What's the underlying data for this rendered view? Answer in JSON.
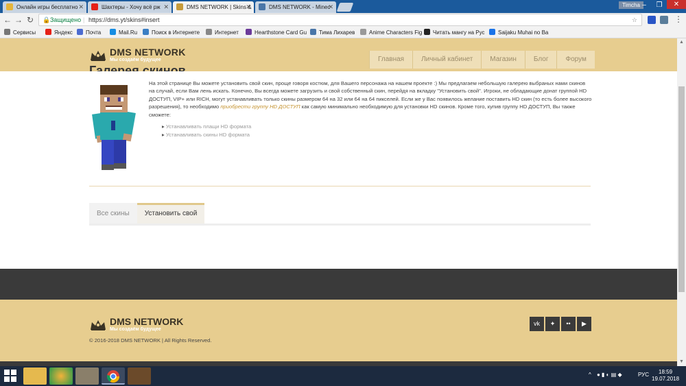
{
  "browser": {
    "tabs": [
      {
        "title": "Онлайн игры бесплатно",
        "favicon_color": "#e5b53c"
      },
      {
        "title": "Шахтеры - Хочу всё рж",
        "favicon_color": "#e62117"
      },
      {
        "title": "DMS NETWORK | Skins &",
        "favicon_color": "#c79b3a"
      },
      {
        "title": "DMS NETWORK - Minec",
        "favicon_color": "#4a76a8"
      }
    ],
    "window_user": "Timcha",
    "url_secure_label": "Защищено",
    "url": "https://dms.yt/skins#insert"
  },
  "bookmarks": [
    {
      "label": "Сервисы",
      "color": "#777"
    },
    {
      "label": "Яндекс",
      "color": "#e62117"
    },
    {
      "label": "Почта",
      "color": "#4b6bd1"
    },
    {
      "label": "Mail.Ru",
      "color": "#168de2"
    },
    {
      "label": "Поиск в Интернете",
      "color": "#3b7fc4"
    },
    {
      "label": "Интернет",
      "color": "#888"
    },
    {
      "label": "Hearthstone Card Gu",
      "color": "#6b3a9a"
    },
    {
      "label": "Тима Лихарев",
      "color": "#4a76a8"
    },
    {
      "label": "Anime Characters Fig",
      "color": "#999"
    },
    {
      "label": "Читать мангу на Рус",
      "color": "#222"
    },
    {
      "label": "Saijaku Muhai no Ba",
      "color": "#1a73e8"
    }
  ],
  "site": {
    "logo_name": "DMS NETWORK",
    "logo_slogan": "Мы создаём будущее",
    "nav": [
      "Главная",
      "Личный кабинет",
      "Магазин",
      "Блог",
      "Форум"
    ],
    "page_title": "Галерея скинов",
    "intro_1": "На этой странице Вы можете установить свой скин, проще говоря костюм, для Вашего персонажа на нашем проекте :) Мы предлагаем небольшую галерею выбраных нами скинов на случай, если Вам лень искать. Конечно, Вы всегда можете загрузить и свой собственный скин, перейдя на вкладку \"Установить свой\". Игроки, не обладающие донат группой HD ДОСТУП, VIP+ или RICH, могут устанавливать только скины размером 64 на 32 или 64 на 64 пикселей. Если же у Вас появилось желание поставить HD скин (то есть более высокого разрешения), то необходимо ",
    "intro_link": "приобрести группу HD ДОСТУП",
    "intro_2": " как самую минимально необходимую для установки HD скинов. Кроме того, купив группу HD ДОСТУП, Вы также сможете:",
    "features": [
      "Устанавливать плащи HD формата",
      "Устанавливать скины HD формата"
    ],
    "skin_tabs": [
      {
        "label": "Все скины",
        "active": false
      },
      {
        "label": "Установить свой",
        "active": true
      }
    ],
    "footer_logo_name": "DMS NETWORK",
    "footer_logo_slogan": "Мы создаём будущее",
    "copyright": "© 2016-2018 DMS NETWORK | All Rights Reserved.",
    "social_icons": [
      "vk-icon",
      "twitter-icon",
      "flickr-icon",
      "youtube-icon"
    ]
  },
  "taskbar": {
    "language": "РУС",
    "time": "18:59",
    "date": "19.07.2018"
  },
  "colors": {
    "header": "#e7cd8f",
    "dark": "#3a3a3a",
    "link": "#c4922e"
  }
}
